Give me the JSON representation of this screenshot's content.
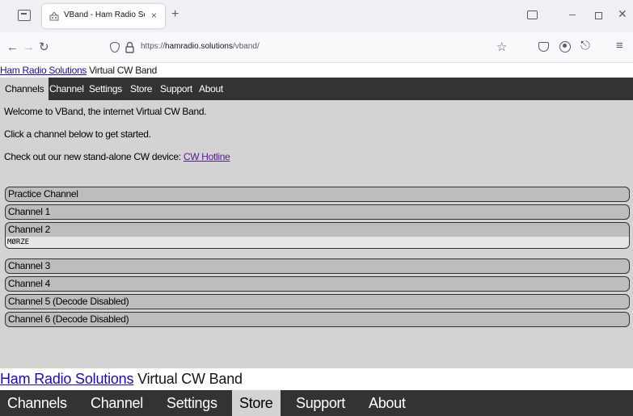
{
  "browser": {
    "tab_title": "VBand - Ham Radio Solutions",
    "tab_close": "×",
    "new_tab": "+",
    "url_prefix": "https://",
    "url_host": "hamradio.solutions",
    "url_path": "/vband/",
    "icons": [
      "tab-list-icon",
      "favicon",
      "close-icon",
      "new-tab-icon",
      "back-icon",
      "forward-icon",
      "reload-icon",
      "shield-icon",
      "lock-icon",
      "bookmark-star-icon",
      "pocket-icon",
      "account-icon",
      "extensions-icon",
      "menu-icon",
      "minimize-icon",
      "maximize-icon",
      "window-close-icon"
    ]
  },
  "site": {
    "brand_link": "Ham Radio Solutions",
    "brand_suffix": " Virtual CW Band",
    "menu": [
      "Channels",
      "Channel",
      "Settings",
      "Store",
      "Support",
      "About"
    ],
    "active_menu": "Channels"
  },
  "main": {
    "welcome": "Welcome to VBand, the internet Virtual CW Band.",
    "instructions": "Click a channel below to get started.",
    "promo_prefix": "Check out our new stand-alone CW device: ",
    "promo_link": "CW Hotline",
    "channels": [
      {
        "name": "Practice Channel",
        "decoded": ""
      },
      {
        "name": "Channel 1",
        "decoded": ""
      },
      {
        "name": "Channel 2",
        "decoded": "MØRZE"
      },
      {
        "name": "Channel 3",
        "decoded": ""
      },
      {
        "name": "Channel 4",
        "decoded": ""
      },
      {
        "name": "Channel 5 (Decode Disabled)",
        "decoded": ""
      },
      {
        "name": "Channel 6 (Decode Disabled)",
        "decoded": ""
      }
    ]
  },
  "footer": {
    "brand_link": "Ham Radio Solutions",
    "brand_suffix": " Virtual CW Band",
    "menu": [
      "Channels",
      "Channel",
      "Settings",
      "Store",
      "Support",
      "About"
    ],
    "highlighted_menu": "Store"
  },
  "colors": {
    "menu_bg": "#333333",
    "content_bg": "#d3d3d3",
    "channel_bg": "#bdbdbd",
    "link": "#1a0dab",
    "visited_link": "#551a8b"
  }
}
